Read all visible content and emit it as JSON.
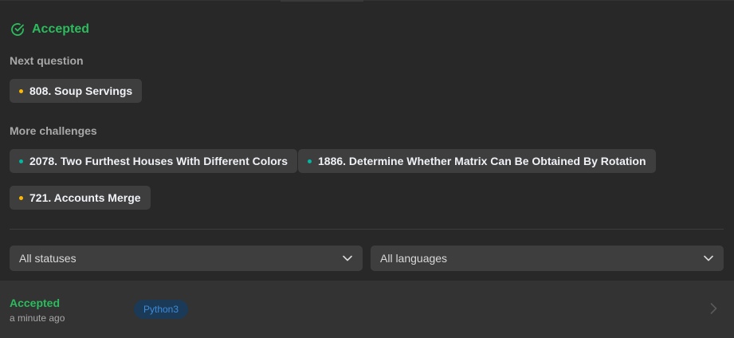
{
  "result": {
    "status": "Accepted",
    "status_color": "#2cbb5d"
  },
  "next_question": {
    "label": "Next question",
    "item": {
      "title": "808. Soup Servings",
      "difficulty_color": "#ffb800"
    }
  },
  "more_challenges": {
    "label": "More challenges",
    "items": [
      {
        "title": "2078. Two Furthest Houses With Different Colors",
        "difficulty_color": "#00b8a3"
      },
      {
        "title": "1886. Determine Whether Matrix Can Be Obtained By Rotation",
        "difficulty_color": "#00b8a3"
      },
      {
        "title": "721. Accounts Merge",
        "difficulty_color": "#ffb800"
      }
    ]
  },
  "filters": {
    "status": {
      "selected": "All statuses",
      "icon": "chevron-down-icon"
    },
    "language": {
      "selected": "All languages",
      "icon": "chevron-down-icon"
    }
  },
  "submissions": [
    {
      "status": "Accepted",
      "time": "a minute ago",
      "language": "Python3"
    }
  ]
}
